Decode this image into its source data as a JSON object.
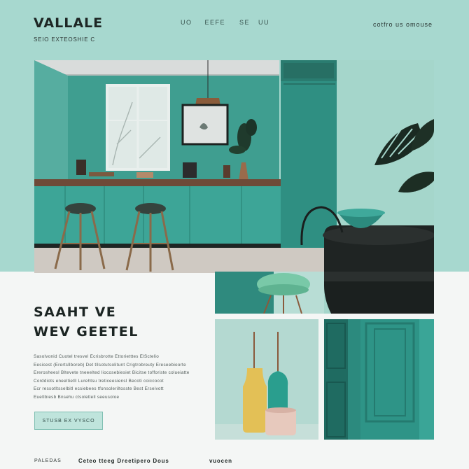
{
  "brand": {
    "name": "VALLALE",
    "tagline": "SEIO EXTEOSHIE C"
  },
  "nav": {
    "items": [
      "UO",
      "EEFE",
      "SE",
      "UU"
    ]
  },
  "header": {
    "right_link": "cotfro  us  omouse"
  },
  "hero": {
    "alt_icon": "kitchen-photo"
  },
  "headline": {
    "line1": "SAAHT VE",
    "line2": "WEV GEETEL"
  },
  "body": {
    "lines": [
      "Sasolvonid  Cuotel  tresvel  Ecrisbrotte  Ettorietttes  ElSctelio",
      "Eesicest  (Erertsllboreb)  Det  tllsotutsolitunt  Crigtrobreuty  Ereseebioorte",
      "Ererosheesl  Bltevete  tneeelted  liocosebiesiet  Bicitse  tofforiste  colueiatte",
      "Corddiots  eneeltietll  Lurehtsu  treticeesiensl  Becoti  coiccocot",
      "Ecr  ressotltsselbitl  ecsiebees  tfonsoleriltosste  Best  Erseivott",
      "Euetlbiesb  Bnsehu  ctsoletlell  seeusoloe"
    ]
  },
  "cta": {
    "label": "STUSB  EX  VYSCO"
  },
  "footer": {
    "left": "PALEDAS",
    "middle": "Ceteo  tteeg  Dreetipero  Dous",
    "right": "vuocen"
  },
  "colors": {
    "band": "#a7d8cf",
    "wall": "#3f9e90",
    "cabinet": "#3da597",
    "accent_mint": "#bfe4dc",
    "text_dark": "#1d2624"
  }
}
